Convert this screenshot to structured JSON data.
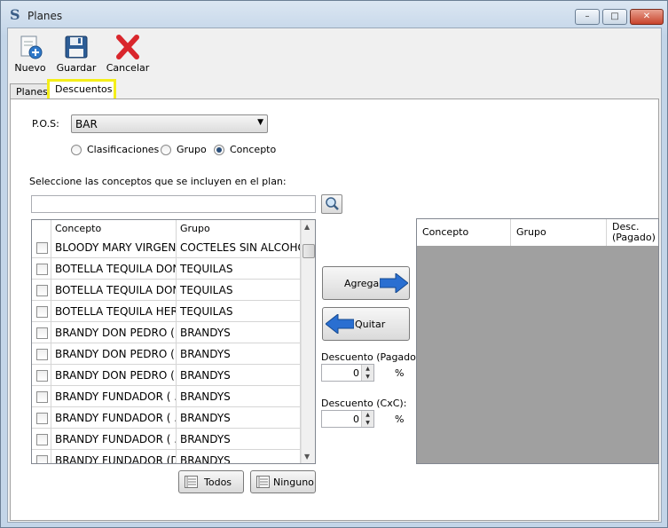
{
  "window": {
    "app_icon": "S",
    "title": "Planes",
    "controls": {
      "minimize": "–",
      "maximize": "□",
      "close": "✕"
    }
  },
  "toolbar": {
    "nuevo_label": "Nuevo",
    "guardar_label": "Guardar",
    "cancelar_label": "Cancelar",
    "icons": {
      "nuevo": "new-document-icon",
      "guardar": "floppy-disk-icon",
      "cancelar": "red-x-icon"
    }
  },
  "tabs": [
    {
      "label": "Planes",
      "active": false
    },
    {
      "label": "Descuentos",
      "active": true
    }
  ],
  "form": {
    "pos_label": "P.O.S:",
    "pos_value": "BAR",
    "radios": [
      {
        "label": "Clasificaciones",
        "checked": false
      },
      {
        "label": "Grupo",
        "checked": false
      },
      {
        "label": "Concepto",
        "checked": true
      }
    ],
    "instruction": "Seleccione las conceptos que se incluyen en el plan:",
    "search_value": ""
  },
  "left_grid": {
    "columns": [
      "Concepto",
      "Grupo"
    ],
    "rows": [
      {
        "concepto": "BLOODY MARY VIRGEN",
        "grupo": "COCTELES SIN ALCOHOL"
      },
      {
        "concepto": "BOTELLA TEQUILA DON...",
        "grupo": "TEQUILAS"
      },
      {
        "concepto": "BOTELLA TEQUILA DON...",
        "grupo": "TEQUILAS"
      },
      {
        "concepto": "BOTELLA TEQUILA HER...",
        "grupo": "TEQUILAS"
      },
      {
        "concepto": "BRANDY DON PEDRO ( ...",
        "grupo": "BRANDYS"
      },
      {
        "concepto": "BRANDY DON PEDRO ( ...",
        "grupo": "BRANDYS"
      },
      {
        "concepto": "BRANDY DON PEDRO (...",
        "grupo": "BRANDYS"
      },
      {
        "concepto": "BRANDY FUNDADOR ( ...",
        "grupo": "BRANDYS"
      },
      {
        "concepto": "BRANDY FUNDADOR ( ...",
        "grupo": "BRANDYS"
      },
      {
        "concepto": "BRANDY FUNDADOR ( ...",
        "grupo": "BRANDYS"
      },
      {
        "concepto": "BRANDY FUNDADOR (D...",
        "grupo": "BRANDYS"
      }
    ]
  },
  "actions": {
    "agregar_label": "Agregar",
    "quitar_label": "Quitar",
    "todos_label": "Todos",
    "ninguno_label": "Ninguno"
  },
  "discounts": {
    "pagado_label": "Descuento (Pagado):",
    "pagado_value": "0",
    "cxc_label": "Descuento (CxC):",
    "cxc_value": "0",
    "percent_symbol": "%"
  },
  "right_grid": {
    "columns": [
      "Concepto",
      "Grupo",
      "Desc.\n(Pagado)"
    ]
  },
  "colors": {
    "tab_highlight": "#f4ee1a",
    "arrow_blue": "#2a6fd1",
    "cancel_red": "#d9262c",
    "empty_grid": "#a0a0a0"
  }
}
